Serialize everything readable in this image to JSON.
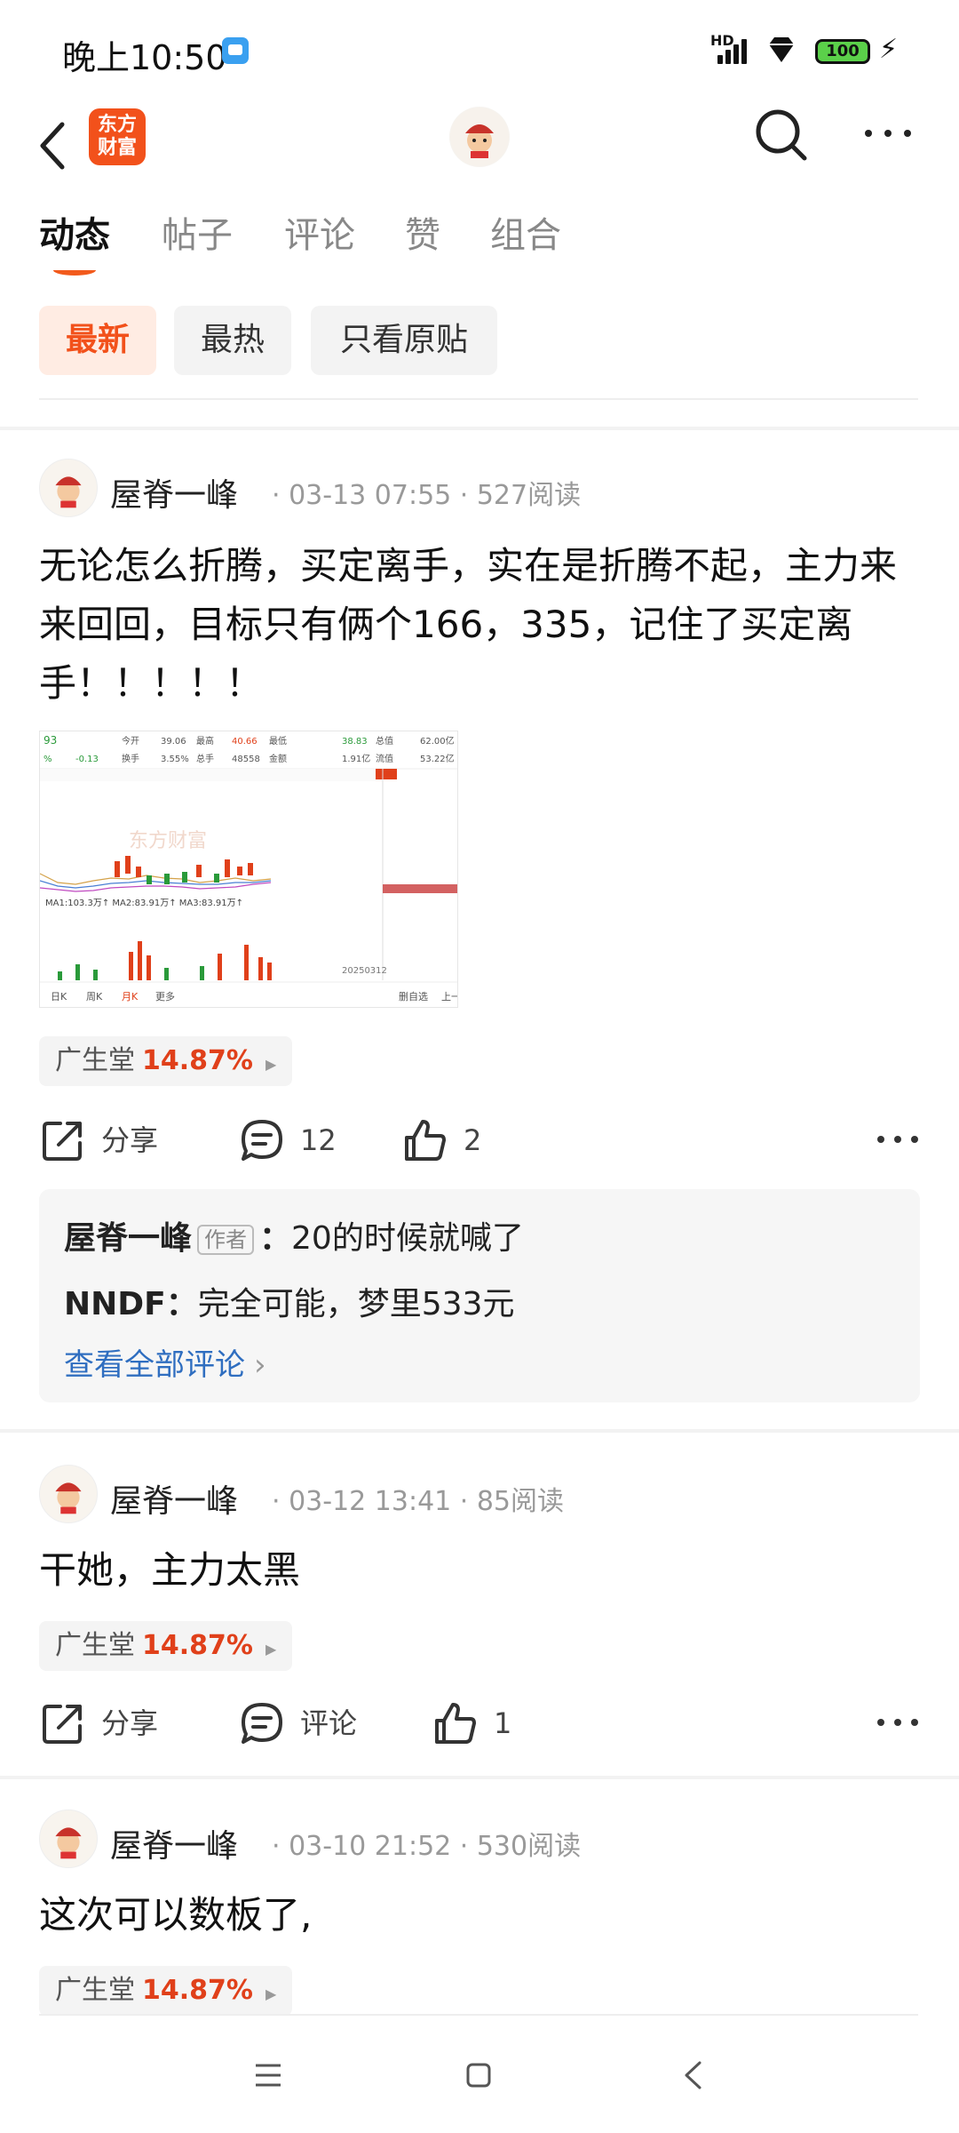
{
  "status_bar": {
    "time": "晚上10:50",
    "signal_label": "HD",
    "battery": "100"
  },
  "nav": {
    "logo_text": "东方\n财富"
  },
  "tabs": [
    {
      "label": "动态",
      "active": true
    },
    {
      "label": "帖子"
    },
    {
      "label": "评论"
    },
    {
      "label": "赞"
    },
    {
      "label": "组合"
    }
  ],
  "filters": [
    {
      "label": "最新",
      "active": true
    },
    {
      "label": "最热"
    },
    {
      "label": "只看原贴"
    }
  ],
  "posts": [
    {
      "author": "屋脊一峰",
      "meta": "· 03-13 07:55 · 527阅读",
      "text": "无论怎么折腾，买定离手，实在是折腾不起，主力来来回回，目标只有俩个166，335，记住了买定离手！！！！！",
      "stock_name": "广生堂",
      "stock_change": "14.87%",
      "share_label": "分享",
      "comment_count": "12",
      "like_count": "2",
      "comments": [
        {
          "user": "屋脊一峰",
          "tag": "作者",
          "text": "20的时候就喊了"
        },
        {
          "user": "NNDF",
          "text": "完全可能，梦里533元"
        }
      ],
      "view_all": "查看全部评论",
      "chart_image": {
        "watermark": "东方财富",
        "row1": [
          "今开",
          "39.06",
          "最高",
          "40.66",
          "最低",
          "38.83",
          "总值",
          "62.00亿"
        ],
        "row2": [
          "换手",
          "3.55%",
          "总手",
          "48558",
          "金额",
          "1.91亿",
          "流值",
          "53.22亿"
        ],
        "ma_line": "MA1:103.3万↑ MA2:83.91万↑ MA3:83.91万↑",
        "date": "20250312",
        "bottom_tabs": [
          "日K",
          "周K",
          "月K",
          "更多"
        ],
        "side_btn": "删自选",
        "side_next": "上一"
      }
    },
    {
      "author": "屋脊一峰",
      "meta": "· 03-12 13:41 · 85阅读",
      "text": "干她，主力太黑",
      "stock_name": "广生堂",
      "stock_change": "14.87%",
      "share_label": "分享",
      "comment_label": "评论",
      "like_count": "1"
    },
    {
      "author": "屋脊一峰",
      "meta": "· 03-10 21:52 · 530阅读",
      "text": "这次可以数板了,",
      "stock_name": "广生堂",
      "stock_change": "14.87%"
    }
  ],
  "colors": {
    "accent": "#f2511b",
    "up": "#e0401a",
    "link": "#2f6ec0"
  }
}
